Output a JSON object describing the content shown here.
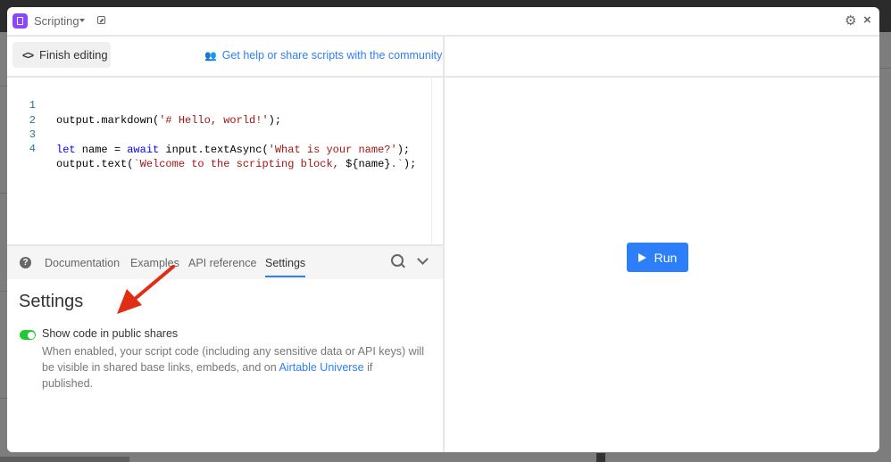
{
  "window": {
    "app_title": "Scripting",
    "icons": {
      "app": "scripting-app-icon",
      "dropdown": "caret-down-icon",
      "popout": "popout-icon",
      "settings": "gear-icon",
      "close": "close-icon"
    }
  },
  "toolbar": {
    "finish_label": "Finish editing",
    "finish_icon": "<>",
    "help_link": "Get help or share scripts with the community"
  },
  "editor": {
    "lines": [
      {
        "num": "1",
        "text": "output.markdown('# Hello, world!');"
      },
      {
        "num": "2",
        "text": ""
      },
      {
        "num": "3",
        "text": "let name = await input.textAsync('What is your name?');"
      },
      {
        "num": "4",
        "text": "output.text(`Welcome to the scripting block, ${name}.`);"
      }
    ]
  },
  "tabs": {
    "help_icon": "?",
    "items": [
      {
        "label": "Documentation",
        "active": false
      },
      {
        "label": "Examples",
        "active": false
      },
      {
        "label": "API reference",
        "active": false
      },
      {
        "label": "Settings",
        "active": true
      }
    ]
  },
  "settings": {
    "title": "Settings",
    "toggle": {
      "label": "Show code in public shares",
      "enabled": true
    },
    "description_before": "When enabled, your script code (including any sensitive data or API keys) will be visible in shared base links, embeds, and on ",
    "description_link": "Airtable Universe",
    "description_after": " if published."
  },
  "run": {
    "label": "Run"
  },
  "colors": {
    "accent": "#2d7ff9",
    "toggle_on": "#20c933",
    "app_icon": "#8b46ff",
    "annotation_arrow": "#e02d14"
  }
}
